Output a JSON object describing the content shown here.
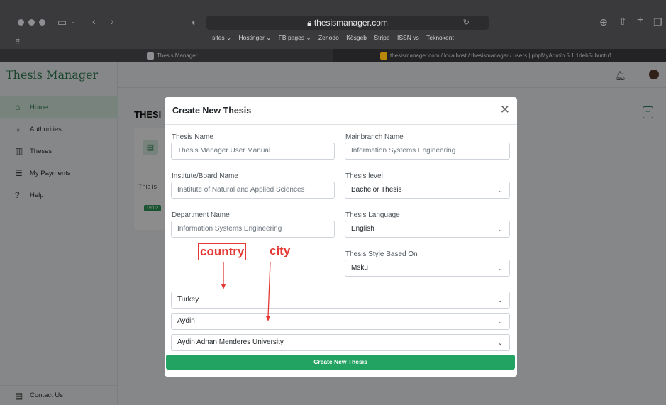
{
  "browser": {
    "url": "thesismanager.com",
    "bookmarks": [
      "sites ⌄",
      "Hostinger ⌄",
      "FB pages ⌄",
      "Zenodo",
      "Kösgeb",
      "Stripe",
      "ISSN vs",
      "Teknokent"
    ],
    "tabs": [
      {
        "label": "Thesis Manager"
      },
      {
        "label": "thesismanager.com / localhost / thesismanager / users | phpMyAdmin 5.1.1deb5ubuntu1"
      }
    ]
  },
  "app": {
    "brand": "Thesis Manager",
    "nav": [
      {
        "label": "Home",
        "icon": "home-icon",
        "active": true
      },
      {
        "label": "Authorities",
        "icon": "award-icon"
      },
      {
        "label": "Theses",
        "icon": "book-icon"
      },
      {
        "label": "My Payments",
        "icon": "list-icon"
      },
      {
        "label": "Help",
        "icon": "help-icon"
      }
    ],
    "contact_label": "Contact Us",
    "page_title": "THESI",
    "card": {
      "text": "This is",
      "badge": "19/02"
    }
  },
  "modal": {
    "title": "Create New Thesis",
    "fields": {
      "thesis_name": {
        "label": "Thesis Name",
        "placeholder": "Thesis Manager User Manual"
      },
      "mainbranch_name": {
        "label": "Mainbranch Name",
        "placeholder": "Information Systems Engineering"
      },
      "institute_name": {
        "label": "Institute/Board Name",
        "placeholder": "Institute of Natural and Applied Sciences"
      },
      "thesis_level": {
        "label": "Thesis level",
        "value": "Bachelor Thesis"
      },
      "department_name": {
        "label": "Department Name",
        "placeholder": "Information Systems Engineering"
      },
      "thesis_language": {
        "label": "Thesis Language",
        "value": "English"
      },
      "thesis_style": {
        "label": "Thesis Style Based On",
        "value": "Msku"
      },
      "country": {
        "value": "Turkey"
      },
      "city": {
        "value": "Aydin"
      },
      "university": {
        "value": "Aydin Adnan Menderes University"
      }
    },
    "submit_label": "Create New Thesis"
  },
  "annotations": {
    "country": "country",
    "city": "city",
    "color": "#e53935"
  },
  "colors": {
    "accent": "#22a361",
    "brand": "#2e7d52"
  }
}
